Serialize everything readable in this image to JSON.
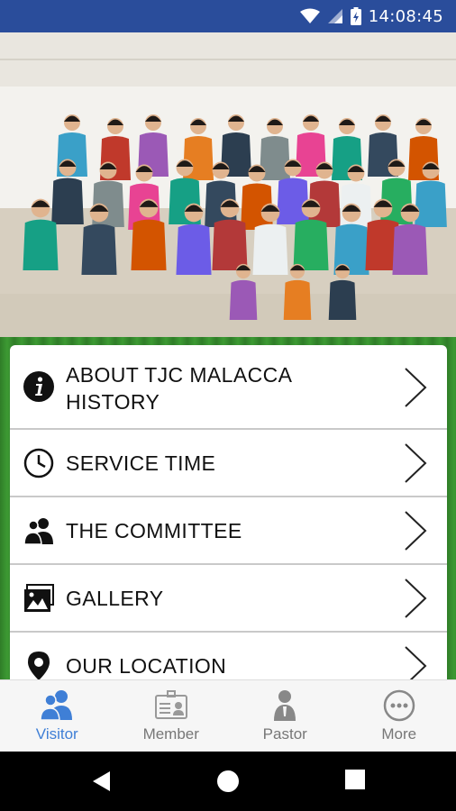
{
  "status_bar": {
    "time": "14:08:45",
    "icons": [
      "wifi-icon",
      "cell-signal-icon",
      "battery-charging-icon"
    ]
  },
  "banner": {
    "image": "congregation-group-photo"
  },
  "menu": {
    "items": [
      {
        "label": "ABOUT TJC MALACCA\nHISTORY",
        "icon": "info-icon"
      },
      {
        "label": "SERVICE TIME",
        "icon": "clock-icon"
      },
      {
        "label": "THE COMMITTEE",
        "icon": "people-icon"
      },
      {
        "label": "GALLERY",
        "icon": "gallery-icon"
      },
      {
        "label": "OUR LOCATION",
        "icon": "location-pin-icon"
      }
    ]
  },
  "bottom_nav": {
    "tabs": [
      {
        "label": "Visitor",
        "icon": "visitor-icon",
        "active": true
      },
      {
        "label": "Member",
        "icon": "member-card-icon",
        "active": false
      },
      {
        "label": "Pastor",
        "icon": "pastor-icon",
        "active": false
      },
      {
        "label": "More",
        "icon": "more-icon",
        "active": false
      }
    ]
  },
  "colors": {
    "status_bar": "#2a4d9b",
    "active_tab": "#3f7fd6",
    "inactive_tab": "#777777",
    "green_backdrop": "#3d9a33"
  }
}
